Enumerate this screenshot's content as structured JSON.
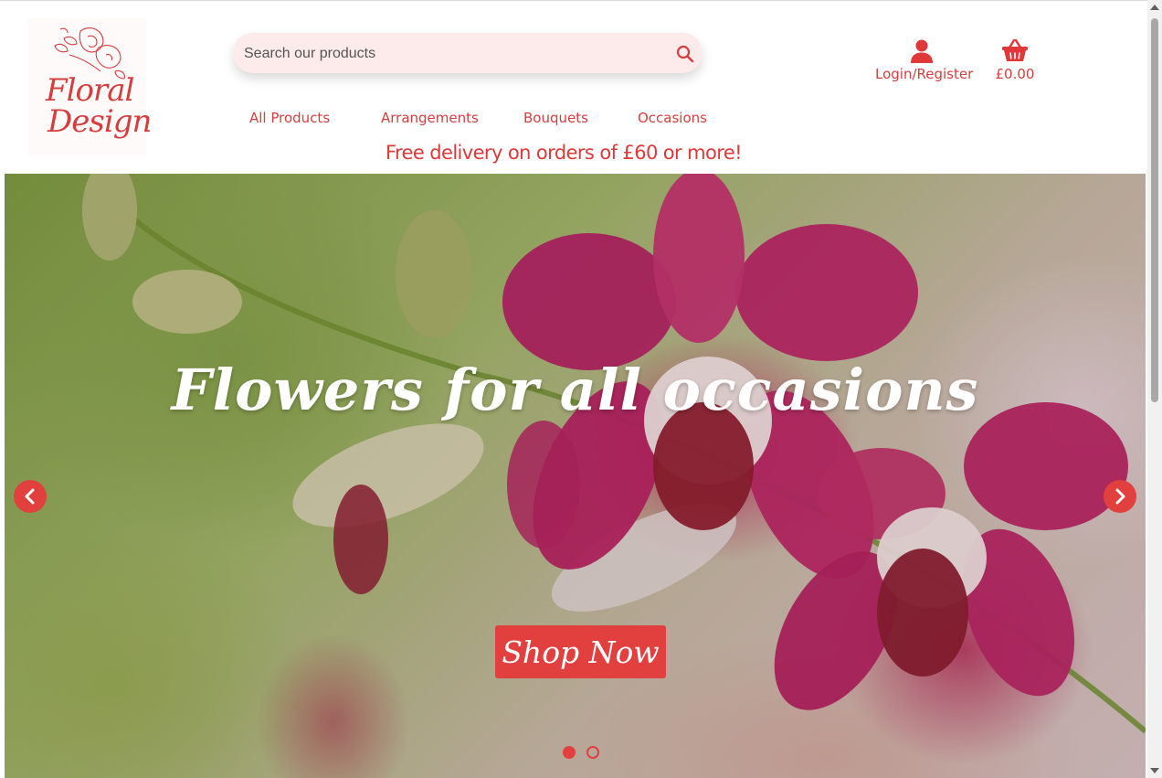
{
  "brand": {
    "name_line1": "Floral",
    "name_line2": "Design",
    "color": "#d63d3d"
  },
  "search": {
    "placeholder": "Search our products",
    "icon": "search-icon"
  },
  "account": {
    "label": "Login/Register",
    "icon": "user-icon"
  },
  "cart": {
    "total": "£0.00",
    "icon": "basket-icon"
  },
  "nav": [
    {
      "label": "All Products"
    },
    {
      "label": "Arrangements"
    },
    {
      "label": "Bouquets"
    },
    {
      "label": "Occasions"
    }
  ],
  "promo": {
    "text": "Free delivery on orders of £60 or more!"
  },
  "hero": {
    "title": "Flowers for all occasions",
    "cta_label": "Shop Now",
    "prev_icon": "chevron-left-icon",
    "next_icon": "chevron-right-icon",
    "slides": [
      {
        "active": true
      },
      {
        "active": false
      }
    ],
    "accent": "#e23f3f"
  }
}
